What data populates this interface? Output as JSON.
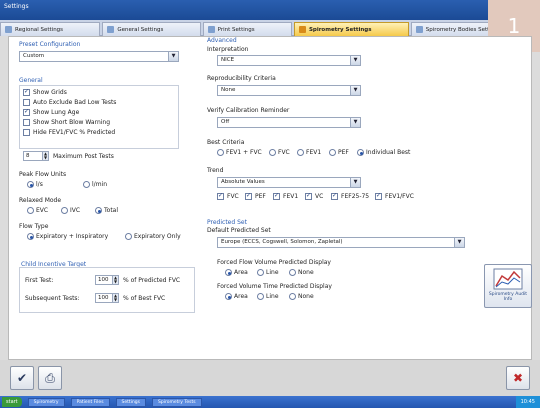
{
  "window": {
    "title": "Settings"
  },
  "tabs": [
    {
      "label": "Regional Settings",
      "active": false,
      "icon": "globe-icon"
    },
    {
      "label": "General Settings",
      "active": false,
      "icon": "tools-icon"
    },
    {
      "label": "Print Settings",
      "active": false,
      "icon": "printer-icon"
    },
    {
      "label": "Spirometry Settings",
      "active": true,
      "icon": "spirometry-icon"
    },
    {
      "label": "Spirometry Bodies Settings",
      "active": false,
      "icon": "body-icon"
    }
  ],
  "badge": {
    "text": "1",
    "color": "#e2c9bd"
  },
  "preset": {
    "title": "Preset Configuration",
    "value": "Custom"
  },
  "general": {
    "title": "General",
    "options": [
      {
        "label": "Show Grids",
        "checked": true
      },
      {
        "label": "Auto Exclude Bad Low Tests",
        "checked": false
      },
      {
        "label": "Show Lung Age",
        "checked": true
      },
      {
        "label": "Show Short Blow Warning",
        "checked": false
      },
      {
        "label": "Hide FEV1/FVC % Predicted",
        "checked": false
      }
    ],
    "max_tests_value": "8",
    "max_tests_label": "Maximum Post Tests"
  },
  "peak_flow_units": {
    "title": "Peak Flow Units",
    "options": [
      "l/s",
      "l/min"
    ],
    "selected": 0
  },
  "relaxed_mode": {
    "title": "Relaxed Mode",
    "options": [
      "EVC",
      "IVC",
      "Total"
    ],
    "selected": 2
  },
  "flow_type": {
    "title": "Flow Type",
    "options": [
      "Expiratory + Inspiratory",
      "Expiratory Only"
    ],
    "selected": 0
  },
  "child_incentive": {
    "title": "Child Incentive Target",
    "first_test_label": "First Test:",
    "first_test_value": "100",
    "first_test_unit": "% of Predicted FVC",
    "subsequent_label": "Subsequent Tests:",
    "subsequent_value": "100",
    "subsequent_unit": "% of Best FVC"
  },
  "advanced": {
    "title": "Advanced",
    "interpretation_label": "Interpretation",
    "interpretation_value": "NICE",
    "reproducibility_label": "Reproducibility Criteria",
    "reproducibility_value": "None",
    "verify_label": "Verify Calibration Reminder",
    "verify_value": "Off",
    "best_criteria_label": "Best Criteria",
    "best_criteria_options": [
      "FEV1 + FVC",
      "FVC",
      "FEV1",
      "PEF",
      "Individual Best"
    ],
    "best_criteria_selected": 4,
    "trend_label": "Trend",
    "trend_value": "Absolute Values",
    "trend_checks": [
      {
        "label": "FVC",
        "checked": true
      },
      {
        "label": "PEF",
        "checked": true
      },
      {
        "label": "FEV1",
        "checked": true
      },
      {
        "label": "VC",
        "checked": true
      },
      {
        "label": "FEF25-75",
        "checked": true
      },
      {
        "label": "FEV1/FVC",
        "checked": true
      }
    ]
  },
  "predicted": {
    "title": "Predicted Set",
    "default_label": "Default Predicted Set",
    "default_value": "Europe (ECCS, Cogswell, Solomon, Zapletal)",
    "forced_flow_label": "Forced Flow Volume Predicted Display",
    "forced_flow_options": [
      "Area",
      "Line",
      "None"
    ],
    "forced_flow_selected": 0,
    "forced_time_label": "Forced Volume Time Predicted Display",
    "forced_time_options": [
      "Area",
      "Line",
      "None"
    ],
    "forced_time_selected": 0
  },
  "side_button": {
    "label": "Spirometry Audit Info"
  },
  "bottom": {
    "close_icon": "close-icon",
    "ok_icon": "ok-icon",
    "print_icon": "print-icon"
  },
  "taskbar": {
    "start": "start",
    "tasks": [
      "Spirometry",
      "Patient Files",
      "Settings",
      "Spirometry Tests"
    ],
    "clock": "10:45"
  }
}
